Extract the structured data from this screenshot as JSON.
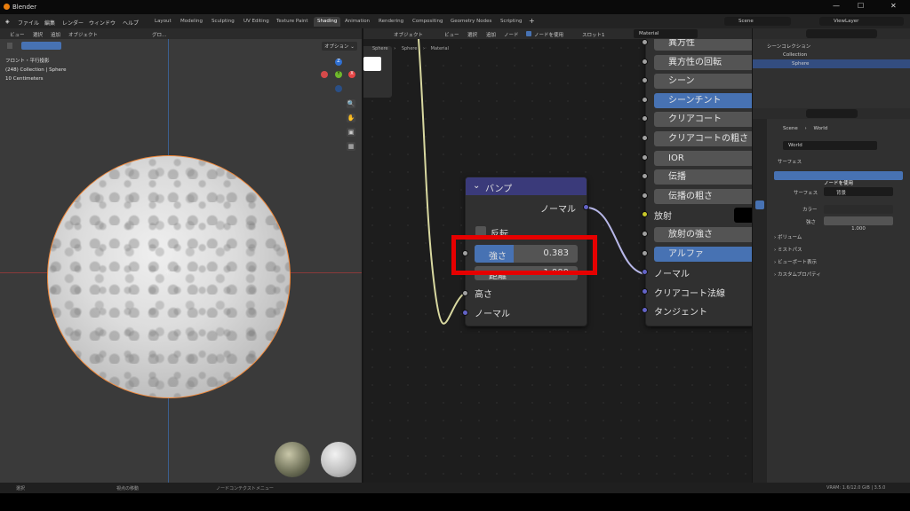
{
  "window": {
    "title": "Blender",
    "min": "—",
    "max": "☐",
    "close": "✕"
  },
  "menu": {
    "items": [
      "ファイル",
      "編集",
      "レンダー",
      "ウィンドウ",
      "ヘルプ"
    ]
  },
  "workspaces": [
    "Layout",
    "Modeling",
    "Sculpting",
    "UV Editing",
    "Texture Paint",
    "Shading",
    "Animation",
    "Rendering",
    "Compositing",
    "Geometry Nodes",
    "Scripting"
  ],
  "workspace_add": "+",
  "scene": {
    "name": "Scene",
    "viewlayer": "ViewLayer"
  },
  "viewport": {
    "header": [
      "ビュー",
      "選択",
      "追加",
      "オブジェクト"
    ],
    "transform": "グロ…",
    "options": "オプション ⌄",
    "info": [
      "フロント・平行投影",
      "(248) Collection | Sphere",
      "10 Centimeters"
    ],
    "gizmo": {
      "z": "Z",
      "x": "X",
      "y": "Y"
    }
  },
  "node_editor": {
    "header": [
      "オブジェクト",
      "ビュー",
      "選択",
      "追加",
      "ノード"
    ],
    "use_nodes": "ノードを使用",
    "slot": "スロット1",
    "material": "Material",
    "breadcrumb": [
      "Sphere",
      "Sphere",
      "Material"
    ],
    "bump": {
      "title": "バンプ",
      "output": "ノーマル",
      "invert": "反転",
      "strength_label": "強さ",
      "strength_value": "0.383",
      "distance_label": "距離",
      "distance_value": "1.000",
      "height": "高さ",
      "normal": "ノーマル"
    },
    "bsdf_rows": [
      {
        "label": "異方性",
        "type": "field",
        "color": "#a1a1a1"
      },
      {
        "label": "異方性の回転",
        "type": "field",
        "color": "#a1a1a1"
      },
      {
        "label": "シーン",
        "type": "field",
        "color": "#a1a1a1"
      },
      {
        "label": "シーンチント",
        "type": "blue",
        "color": "#a1a1a1"
      },
      {
        "label": "クリアコート",
        "type": "field",
        "color": "#a1a1a1"
      },
      {
        "label": "クリアコートの粗さ",
        "type": "field",
        "color": "#a1a1a1"
      },
      {
        "label": "IOR",
        "type": "field",
        "color": "#a1a1a1"
      },
      {
        "label": "伝播",
        "type": "field",
        "color": "#a1a1a1"
      },
      {
        "label": "伝播の粗さ",
        "type": "field",
        "color": "#a1a1a1"
      },
      {
        "label": "放射",
        "type": "color",
        "color": "#c7c729"
      },
      {
        "label": "放射の強さ",
        "type": "field",
        "color": "#a1a1a1"
      },
      {
        "label": "アルファ",
        "type": "blue",
        "color": "#a1a1a1"
      },
      {
        "label": "ノーマル",
        "type": "plain",
        "color": "#6363c7"
      },
      {
        "label": "クリアコート法線",
        "type": "plain",
        "color": "#6363c7"
      },
      {
        "label": "タンジェント",
        "type": "plain",
        "color": "#6363c7"
      }
    ]
  },
  "outliner": {
    "title": "シーンコレクション",
    "collection": "Collection",
    "object": "Sphere"
  },
  "properties": {
    "breadcrumb": [
      "Scene",
      "World"
    ],
    "world": "World",
    "surface_panel": "サーフェス",
    "use_nodes_btn": "ノードを使用",
    "surface_label": "サーフェス",
    "surface_value": "背景",
    "color_label": "カラー",
    "strength_label": "強さ",
    "strength_value": "1.000",
    "panels": [
      "ボリューム",
      "ミストパス",
      "ビューポート表示",
      "カスタムプロパティ"
    ]
  },
  "statusbar": {
    "select": "選択",
    "pan": "視点の移動",
    "context": "ノードコンテクストメニュー",
    "version": "VRAM: 1.6/12.0 GiB | 3.5.0"
  },
  "colors": {
    "accent": "#4772b3",
    "highlight": "#e60000",
    "selection_orange": "#f0883a"
  }
}
